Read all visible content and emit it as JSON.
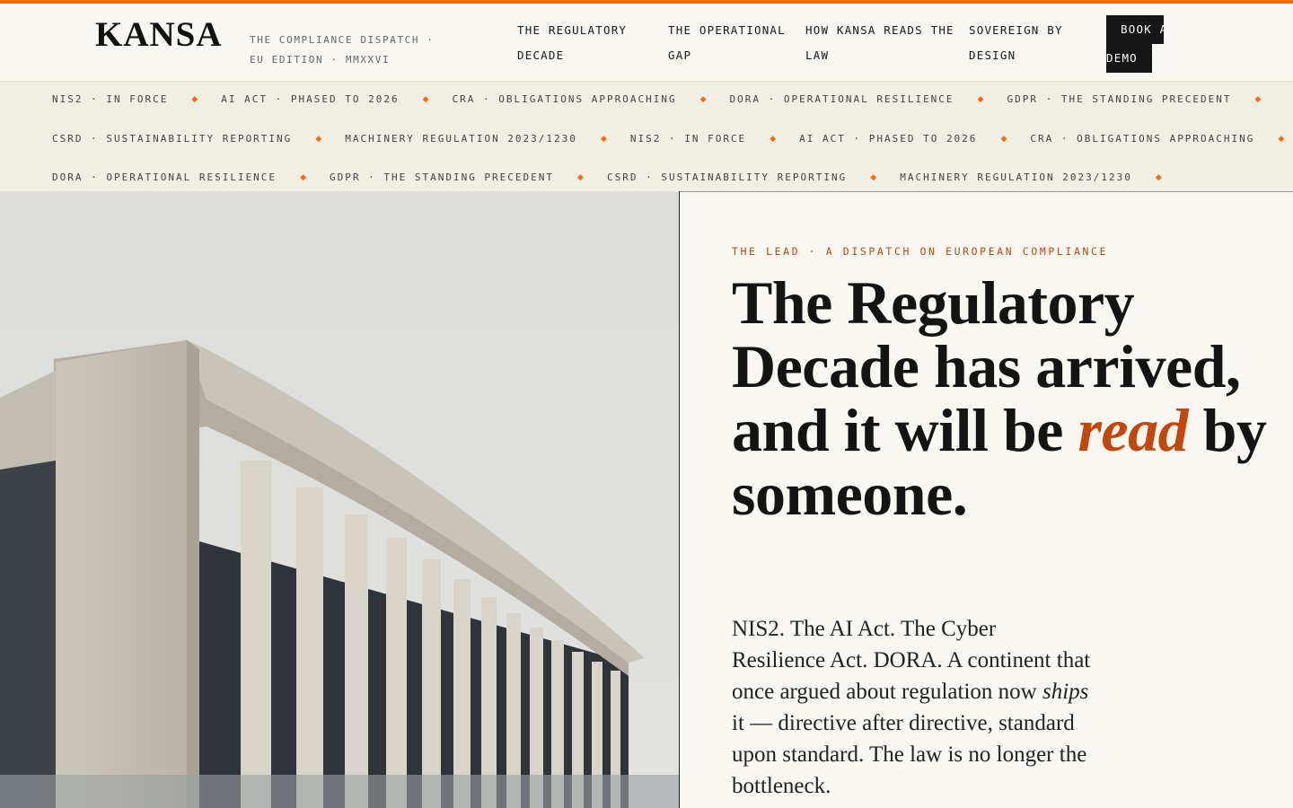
{
  "brand": {
    "logo": "KANSA",
    "tagline_line1": "THE COMPLIANCE DISPATCH ·",
    "tagline_line2": "EU EDITION · MMXXVI",
    "accent_color": "#ff6a00"
  },
  "nav": {
    "items": [
      {
        "line1": "THE REGULATORY",
        "line2": "DECADE"
      },
      {
        "line1": "THE OPERATIONAL",
        "line2": "GAP"
      },
      {
        "line1": "HOW KANSA READS THE",
        "line2": "LAW"
      },
      {
        "line1": "SOVEREIGN BY",
        "line2": "DESIGN"
      }
    ],
    "cta_line1": "BOOK A",
    "cta_line2": "DEMO"
  },
  "ticker": {
    "rows": [
      [
        "NIS2 · IN FORCE",
        "AI ACT · PHASED TO 2026",
        "CRA · OBLIGATIONS APPROACHING",
        "DORA · OPERATIONAL RESILIENCE",
        "GDPR · THE STANDING PRECEDENT"
      ],
      [
        "CSRD · SUSTAINABILITY REPORTING",
        "MACHINERY REGULATION 2023/1230",
        "NIS2 · IN FORCE",
        "AI ACT · PHASED TO 2026",
        "CRA · OBLIGATIONS APPROACHING"
      ],
      [
        "DORA · OPERATIONAL RESILIENCE",
        "GDPR · THE STANDING PRECEDENT",
        "CSRD · SUSTAINABILITY REPORTING",
        "MACHINERY REGULATION 2023/1230"
      ]
    ],
    "separator": "◆"
  },
  "hero": {
    "kicker": "THE LEAD · A DISPATCH ON EUROPEAN COMPLIANCE",
    "headline_before": "The Regulatory Decade has arrived, and it will be",
    "headline_em": "read",
    "headline_after": "by someone.",
    "lede_before": "NIS2. The AI Act. The Cyber Resilience Act. DORA. A continent that once argued about regulation now",
    "lede_em": "ships",
    "lede_after": "it — directive after directive, standard upon standard. The law is no longer the bottleneck."
  }
}
